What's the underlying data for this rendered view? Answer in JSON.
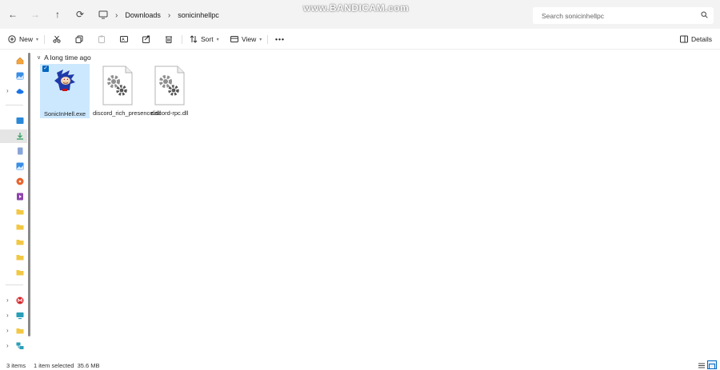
{
  "nav": {
    "back": "←",
    "forward": "→",
    "up": "↑",
    "refresh": "⟳"
  },
  "breadcrumb": {
    "items": [
      "Downloads",
      "sonicinhellpc"
    ],
    "separator": "›"
  },
  "search": {
    "placeholder": "Search sonicinhellpc"
  },
  "watermark": "www.BANDICAM.com",
  "toolbar": {
    "new_label": "New",
    "sort_label": "Sort",
    "view_label": "View",
    "more_label": "•••",
    "details_label": "Details"
  },
  "content": {
    "group_label": "A long time ago",
    "files": [
      {
        "name": "SonicInHell.exe",
        "selected": true
      },
      {
        "name": "discord_rich_presence.dll",
        "selected": false
      },
      {
        "name": "discord-rpc.dll",
        "selected": false
      }
    ]
  },
  "status": {
    "items_count": "3 items",
    "selection": "1 item selected  35.6 MB"
  },
  "colors": {
    "accent": "#0067c0",
    "selection": "#cce8ff",
    "folder": "#f2c744"
  }
}
